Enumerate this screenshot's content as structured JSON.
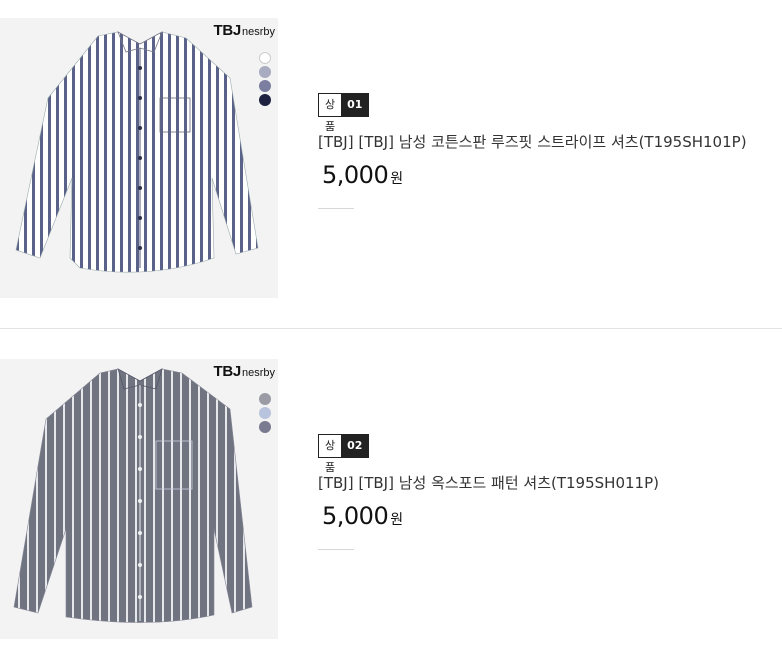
{
  "products": [
    {
      "brand_main": "TBJ",
      "brand_sub": "nesrby",
      "badge_label": "상품",
      "badge_num": "01",
      "name": "[TBJ] [TBJ] 남성 코튼스판 루즈핏 스트라이프 셔츠(T195SH101P)",
      "price": "5,000",
      "currency": "원",
      "swatch_colors": [
        "#ffffff",
        "#a9abc1",
        "#7b7ea0",
        "#1e2240"
      ],
      "stripe_colors": [
        "#5b6289",
        "#ffffff"
      ]
    },
    {
      "brand_main": "TBJ",
      "brand_sub": "nesrby",
      "badge_label": "상품",
      "badge_num": "02",
      "name": "[TBJ] [TBJ] 남성 옥스포드 패턴 셔츠(T195SH011P)",
      "price": "5,000",
      "currency": "원",
      "swatch_colors": [
        "#9b9ba6",
        "#b8c3de",
        "#7a7a90"
      ],
      "stripe_colors": [
        "#6f7480",
        "#e6e8ec"
      ]
    }
  ]
}
